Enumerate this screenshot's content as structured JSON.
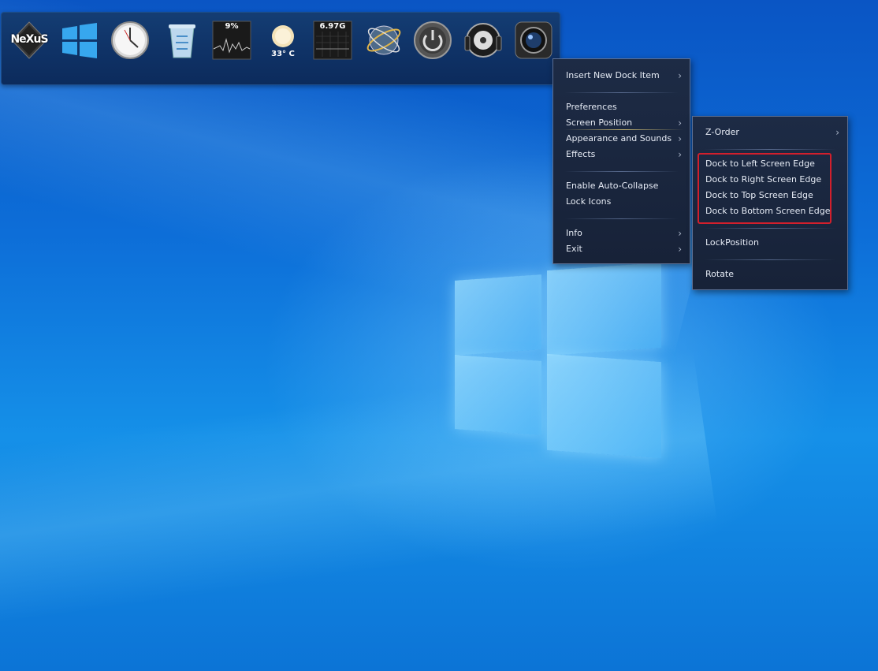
{
  "desktop": {
    "accent": "#0c74d6"
  },
  "dock": {
    "items": [
      {
        "name": "nexus-logo",
        "label": "NeXuS"
      },
      {
        "name": "windows-start",
        "label": ""
      },
      {
        "name": "clock",
        "label": ""
      },
      {
        "name": "recycle-bin",
        "label": ""
      },
      {
        "name": "cpu-meter",
        "label": "9%"
      },
      {
        "name": "weather",
        "label": "33° C"
      },
      {
        "name": "memory-meter",
        "label": "6.97G"
      },
      {
        "name": "internet-globe",
        "label": ""
      },
      {
        "name": "power",
        "label": ""
      },
      {
        "name": "media-player",
        "label": ""
      },
      {
        "name": "camera",
        "label": ""
      }
    ]
  },
  "context_menu": {
    "items": [
      {
        "label": "Insert New Dock Item",
        "has_submenu": true
      },
      {
        "label": "Preferences",
        "has_submenu": false
      },
      {
        "label": "Screen Position",
        "has_submenu": true,
        "selected": true
      },
      {
        "label": "Appearance and Sounds",
        "has_submenu": true
      },
      {
        "label": "Effects",
        "has_submenu": true
      },
      {
        "label": "Enable Auto-Collapse",
        "has_submenu": false
      },
      {
        "label": "Lock Icons",
        "has_submenu": false
      },
      {
        "label": "Info",
        "has_submenu": true
      },
      {
        "label": "Exit",
        "has_submenu": true
      }
    ],
    "arrow_glyph": "›"
  },
  "submenu": {
    "items": [
      {
        "label": "Z-Order",
        "has_submenu": true
      },
      {
        "label": "Dock to Left Screen Edge"
      },
      {
        "label": "Dock to Right Screen Edge"
      },
      {
        "label": "Dock to Top Screen Edge"
      },
      {
        "label": "Dock to Bottom Screen Edge"
      },
      {
        "label": "LockPosition"
      },
      {
        "label": "Rotate"
      }
    ],
    "highlight_color": "#d21f2c"
  }
}
